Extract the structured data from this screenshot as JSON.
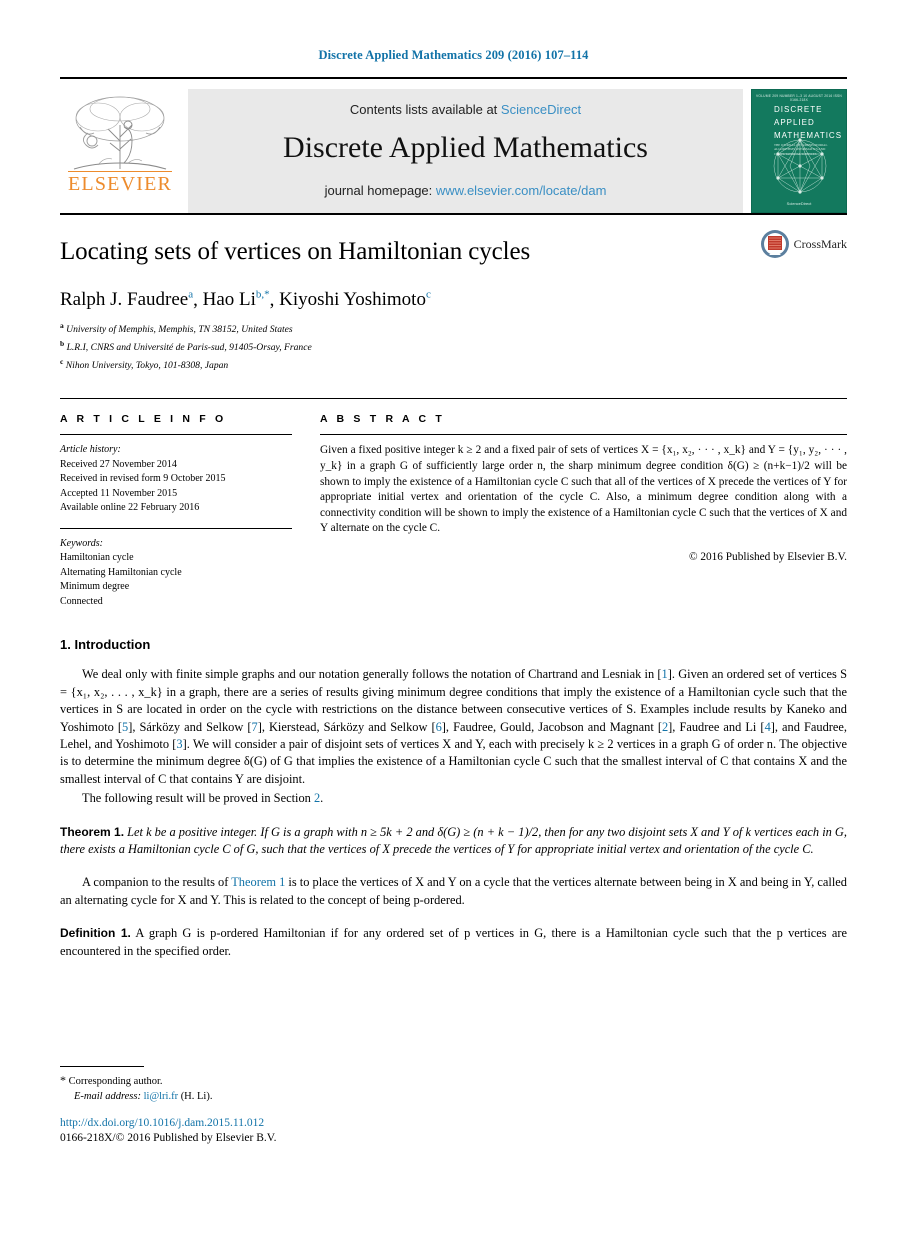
{
  "running_head": "Discrete Applied Mathematics 209 (2016) 107–114",
  "masthead": {
    "contents_prefix": "Contents lists available at ",
    "contents_link": "ScienceDirect",
    "journal_name": "Discrete Applied Mathematics",
    "homepage_prefix": "journal homepage: ",
    "homepage_link": "www.elsevier.com/locate/dam",
    "publisher_wordmark": "ELSEVIER",
    "cover": {
      "top_strip": "VOLUME 209          NUMBER 1–3          10 AUGUST 2016          ISSN 0166-218X",
      "line1": "DISCRETE",
      "line2": "APPLIED",
      "line3": "MATHEMATICS",
      "subtitle": "THE JOURNAL OF COMBINATORIAL ALGORITHMS, INFORMATICS AND COMPUTATIONAL SCIENCES",
      "footer": "ScienceDirect"
    }
  },
  "article": {
    "title": "Locating sets of vertices on Hamiltonian cycles",
    "authors": [
      {
        "name": "Ralph J. Faudree",
        "marks": "a",
        "sep": ", "
      },
      {
        "name": "Hao Li",
        "marks": "b,*",
        "sep": ", "
      },
      {
        "name": "Kiyoshi Yoshimoto",
        "marks": "c",
        "sep": ""
      }
    ],
    "affiliations": [
      {
        "mark": "a",
        "text": "University of Memphis, Memphis, TN 38152, United States"
      },
      {
        "mark": "b",
        "text": "L.R.I, CNRS and Université de Paris-sud, 91405-Orsay, France"
      },
      {
        "mark": "c",
        "text": "Nihon University, Tokyo, 101-8308, Japan"
      }
    ],
    "crossmark_label": "CrossMark"
  },
  "article_info": {
    "heading": "A R T I C L E   I N F O",
    "history_title": "Article history:",
    "history": [
      "Received 27 November 2014",
      "Received in revised form 9 October 2015",
      "Accepted 11 November 2015",
      "Available online 22 February 2016"
    ],
    "keywords_title": "Keywords:",
    "keywords": [
      "Hamiltonian cycle",
      "Alternating Hamiltonian cycle",
      "Minimum degree",
      "Connected"
    ]
  },
  "abstract": {
    "heading": "A B S T R A C T",
    "text": "Given a fixed positive integer k ≥ 2 and a fixed pair of sets of vertices X = {x₁, x₂, · · · , x_k} and Y = {y₁, y₂, · · · , y_k} in a graph G of sufficiently large order n, the sharp minimum degree condition δ(G) ≥ (n+k−1)/2 will be shown to imply the existence of a Hamiltonian cycle C such that all of the vertices of X precede the vertices of Y for appropriate initial vertex and orientation of the cycle C. Also, a minimum degree condition along with a connectivity condition will be shown to imply the existence of a Hamiltonian cycle C such that the vertices of X and Y alternate on the cycle C.",
    "copyright": "© 2016 Published by Elsevier B.V."
  },
  "body": {
    "section_heading": "1. Introduction",
    "para1": "We deal only with finite simple graphs and our notation generally follows the notation of Chartrand and Lesniak in [1]. Given an ordered set of vertices S = {x₁, x₂, . . . , x_k} in a graph, there are a series of results giving minimum degree conditions that imply the existence of a Hamiltonian cycle such that the vertices in S are located in order on the cycle with restrictions on the distance between consecutive vertices of S. Examples include results by Kaneko and Yoshimoto [5], Sárközy and Selkow [7], Kierstead, Sárközy and Selkow [6], Faudree, Gould, Jacobson and Magnant [2], Faudree and Li [4], and Faudree, Lehel, and Yoshimoto [3]. We will consider a pair of disjoint sets of vertices X and Y, each with precisely k ≥ 2 vertices in a graph G of order n. The objective is to determine the minimum degree δ(G) of G that implies the existence of a Hamiltonian cycle C such that the smallest interval of C that contains X and the smallest interval of C that contains Y are disjoint.",
    "para2": "The following result will be proved in Section 2.",
    "theorem_label": "Theorem 1.",
    "theorem_text": "Let k be a positive integer. If G is a graph with n ≥ 5k + 2 and δ(G) ≥ (n + k − 1)/2, then for any two disjoint sets X and Y of k vertices each in G, there exists a Hamiltonian cycle C of G, such that the vertices of X precede the vertices of Y for appropriate initial vertex and orientation of the cycle C.",
    "para3": "A companion to the results of Theorem 1 is to place the vertices of X and Y on a cycle that the vertices alternate between being in X and being in Y, called an alternating cycle for X and Y. This is related to the concept of being p-ordered.",
    "definition_label": "Definition 1.",
    "definition_text": "A graph G is p-ordered Hamiltonian if for any ordered set of p vertices in G, there is a Hamiltonian cycle such that the p vertices are encountered in the specified order.",
    "link_theorem1": "Theorem 1",
    "link_section2": "2",
    "refs": {
      "r1": "1",
      "r2": "2",
      "r3": "3",
      "r4": "4",
      "r5": "5",
      "r6": "6",
      "r7": "7"
    }
  },
  "footer": {
    "corresponding_star": "*",
    "corresponding_text": "Corresponding author.",
    "email_label": "E-mail address:",
    "email": "li@lri.fr",
    "email_suffix": "(H. Li).",
    "doi": "http://dx.doi.org/10.1016/j.dam.2015.11.012",
    "issn_line": "0166-218X/© 2016 Published by Elsevier B.V."
  },
  "colors": {
    "link_blue": "#1273a8",
    "elsevier_orange": "#ed8b2c",
    "cover_green": "#13795e",
    "masthead_gray": "#e9e9e9"
  }
}
